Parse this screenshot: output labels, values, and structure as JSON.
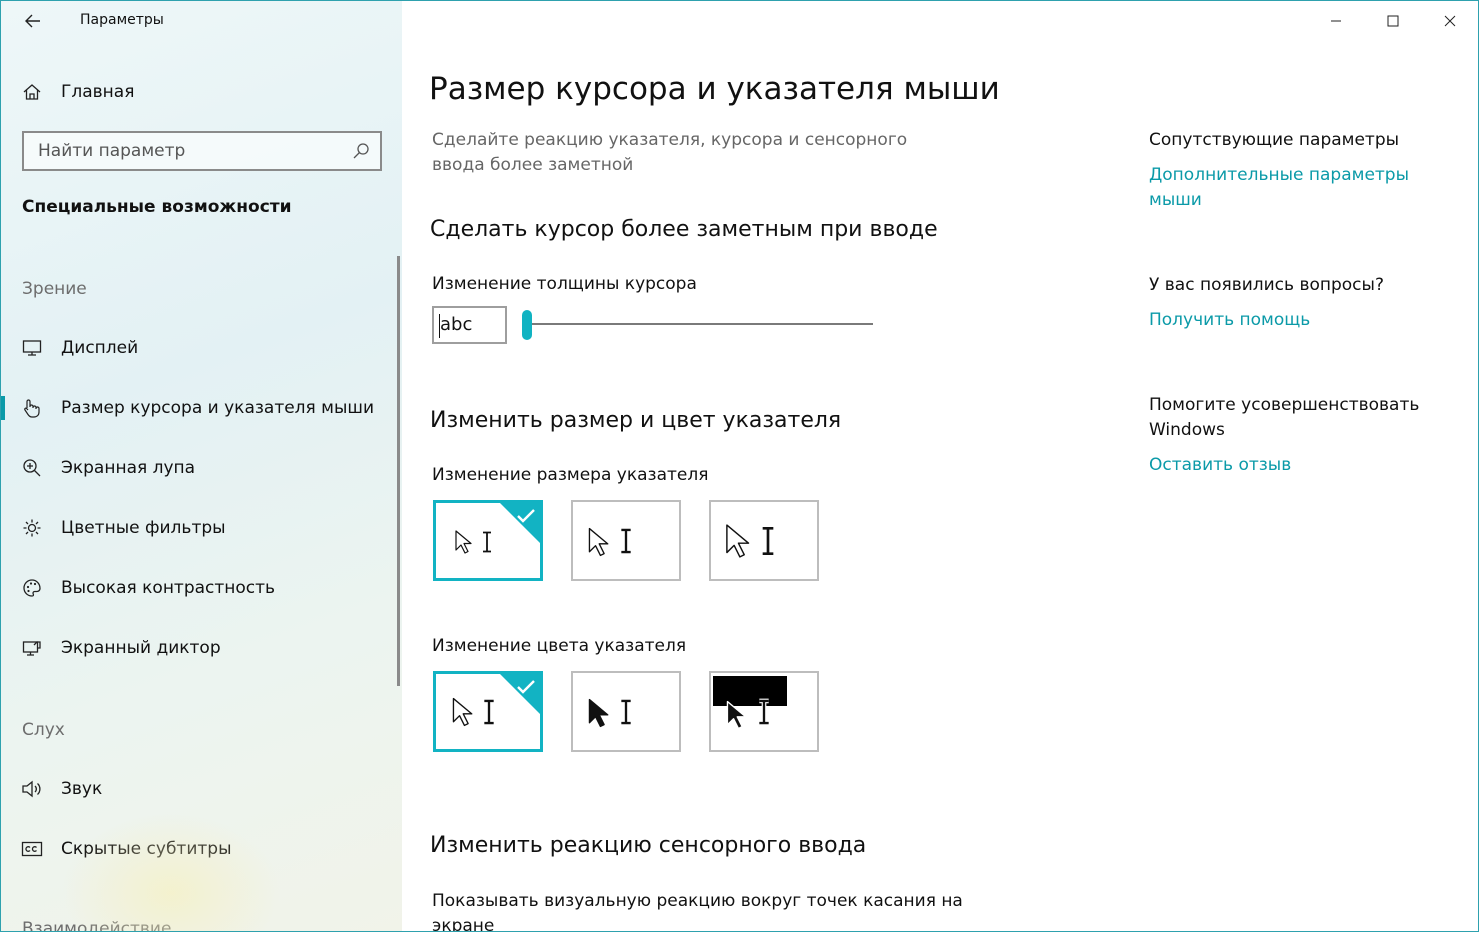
{
  "window": {
    "app_title": "Параметры",
    "controls": {
      "minimize": "minimize",
      "maximize": "maximize",
      "close": "close"
    }
  },
  "sidebar": {
    "home_label": "Главная",
    "search_placeholder": "Найти параметр",
    "section_heading": "Специальные возможности",
    "groups": [
      {
        "label": "Зрение",
        "items": [
          {
            "label": "Дисплей",
            "icon": "display-icon"
          },
          {
            "label": "Размер курсора и указателя мыши",
            "icon": "pointer-hand-icon",
            "selected": true
          },
          {
            "label": "Экранная лупа",
            "icon": "magnifier-icon"
          },
          {
            "label": "Цветные фильтры",
            "icon": "sun-icon"
          },
          {
            "label": "Высокая контрастность",
            "icon": "palette-icon"
          },
          {
            "label": "Экранный диктор",
            "icon": "narrator-icon"
          }
        ]
      },
      {
        "label": "Слух",
        "items": [
          {
            "label": "Звук",
            "icon": "speaker-icon"
          },
          {
            "label": "Скрытые субтитры",
            "icon": "cc-icon"
          }
        ]
      },
      {
        "label": "Взаимодействие",
        "items": []
      }
    ]
  },
  "main": {
    "page_title": "Размер курсора и указателя мыши",
    "page_desc": "Сделайте реакцию указателя, курсора и сенсорного ввода более заметной",
    "section_cursor": {
      "title": "Сделать курсор более заметным при вводе",
      "thickness_label": "Изменение толщины курсора",
      "preview_text": "abc",
      "thickness_value": 1
    },
    "section_pointer": {
      "title": "Изменить размер и цвет указателя",
      "size_label": "Изменение размера указателя",
      "size_options": [
        {
          "name": "pointer-size-small",
          "selected": true
        },
        {
          "name": "pointer-size-medium",
          "selected": false
        },
        {
          "name": "pointer-size-large",
          "selected": false
        }
      ],
      "color_label": "Изменение цвета указателя",
      "color_options": [
        {
          "name": "pointer-color-white",
          "selected": true
        },
        {
          "name": "pointer-color-black",
          "selected": false
        },
        {
          "name": "pointer-color-inverted",
          "selected": false
        }
      ]
    },
    "section_touch": {
      "title": "Изменить реакцию сенсорного ввода",
      "desc": "Показывать визуальную реакцию вокруг точек касания на экране"
    }
  },
  "related": {
    "heading": "Сопутствующие параметры",
    "link": "Дополнительные параметры мыши",
    "questions_heading": "У вас появились вопросы?",
    "help_link": "Получить помощь",
    "improve_heading": "Помогите усовершенствовать Windows",
    "feedback_link": "Оставить отзыв"
  },
  "colors": {
    "accent": "#12b3c3",
    "link": "#0b9aa8"
  }
}
